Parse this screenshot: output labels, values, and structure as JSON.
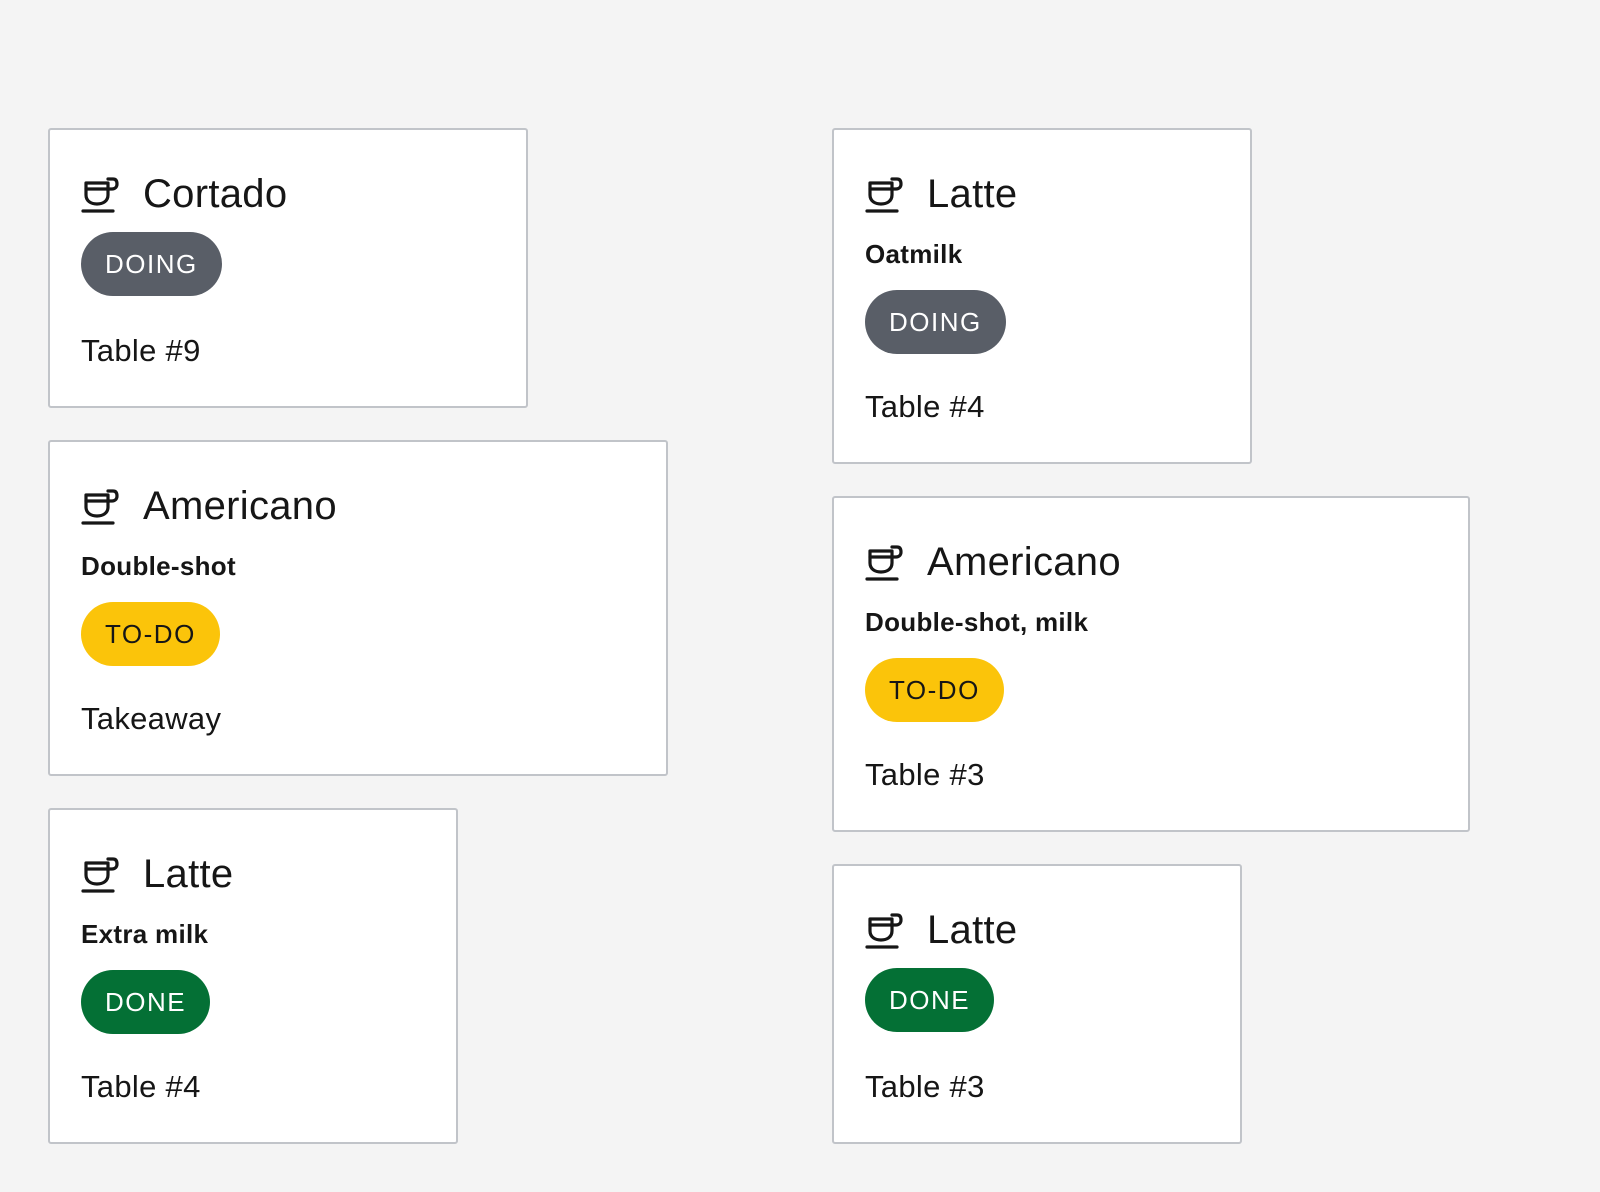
{
  "colors": {
    "background": "#f4f4f4",
    "card_border": "#c1c4c9",
    "doing": "#595e67",
    "todo": "#fbc40a",
    "done": "#047035"
  },
  "orders": [
    {
      "icon": "coffee-cup-icon",
      "drink": "Cortado",
      "note": "",
      "status": "DOING",
      "location": "Table #9"
    },
    {
      "icon": "coffee-cup-icon",
      "drink": "Americano",
      "note": "Double-shot",
      "status": "TO-DO",
      "location": "Takeaway"
    },
    {
      "icon": "coffee-cup-icon",
      "drink": "Latte",
      "note": "Extra milk",
      "status": "DONE",
      "location": "Table #4"
    },
    {
      "icon": "coffee-cup-icon",
      "drink": "Latte",
      "note": "Oatmilk",
      "status": "DOING",
      "location": "Table #4"
    },
    {
      "icon": "coffee-cup-icon",
      "drink": "Americano",
      "note": "Double-shot, milk",
      "status": "TO-DO",
      "location": "Table #3"
    },
    {
      "icon": "coffee-cup-icon",
      "drink": "Latte",
      "note": "",
      "status": "DONE",
      "location": "Table #3"
    }
  ]
}
